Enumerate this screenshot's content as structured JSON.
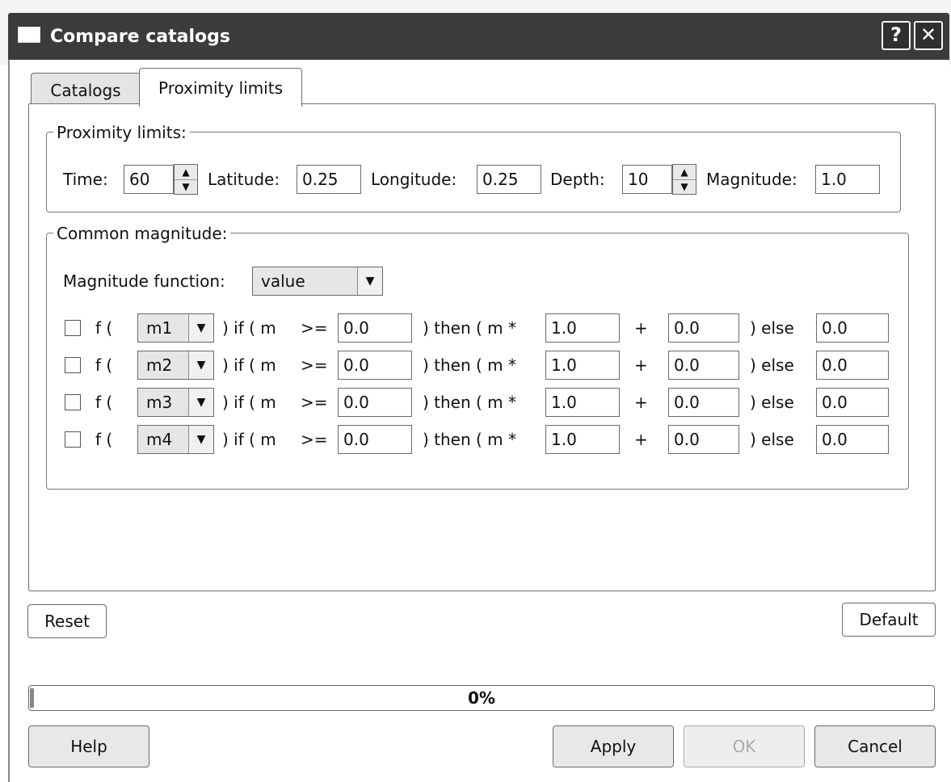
{
  "window": {
    "title": "Compare catalogs",
    "help_glyph": "?",
    "close_glyph": "✕"
  },
  "tabs": [
    {
      "label": "Catalogs",
      "active": false
    },
    {
      "label": "Proximity limits",
      "active": true
    }
  ],
  "proximity": {
    "legend": "Proximity limits:",
    "time_label": "Time:",
    "time_value": "60",
    "latitude_label": "Latitude:",
    "latitude_value": "0.25",
    "longitude_label": "Longitude:",
    "longitude_value": "0.25",
    "depth_label": "Depth:",
    "depth_value": "10",
    "magnitude_label": "Magnitude:",
    "magnitude_value": "1.0"
  },
  "common": {
    "legend": "Common magnitude:",
    "function_label": "Magnitude function:",
    "function_value": "value",
    "text": {
      "f_open": "f (",
      "if_m": ") if ( m",
      "gte": ">=",
      "then": ") then ( m *",
      "plus": "+",
      "else": ") else"
    },
    "rows": [
      {
        "checked": false,
        "mag": "m1",
        "threshold": "0.0",
        "mult": "1.0",
        "add": "0.0",
        "else": "0.0"
      },
      {
        "checked": false,
        "mag": "m2",
        "threshold": "0.0",
        "mult": "1.0",
        "add": "0.0",
        "else": "0.0"
      },
      {
        "checked": false,
        "mag": "m3",
        "threshold": "0.0",
        "mult": "1.0",
        "add": "0.0",
        "else": "0.0"
      },
      {
        "checked": false,
        "mag": "m4",
        "threshold": "0.0",
        "mult": "1.0",
        "add": "0.0",
        "else": "0.0"
      }
    ]
  },
  "buttons": {
    "reset": "Reset",
    "default": "Default",
    "help": "Help",
    "apply": "Apply",
    "ok": "OK",
    "cancel": "Cancel"
  },
  "progress": {
    "text": "0%",
    "value": 0.0
  },
  "icons": {
    "spin_up": "▲",
    "spin_down": "▼",
    "dropdown": "▼"
  }
}
